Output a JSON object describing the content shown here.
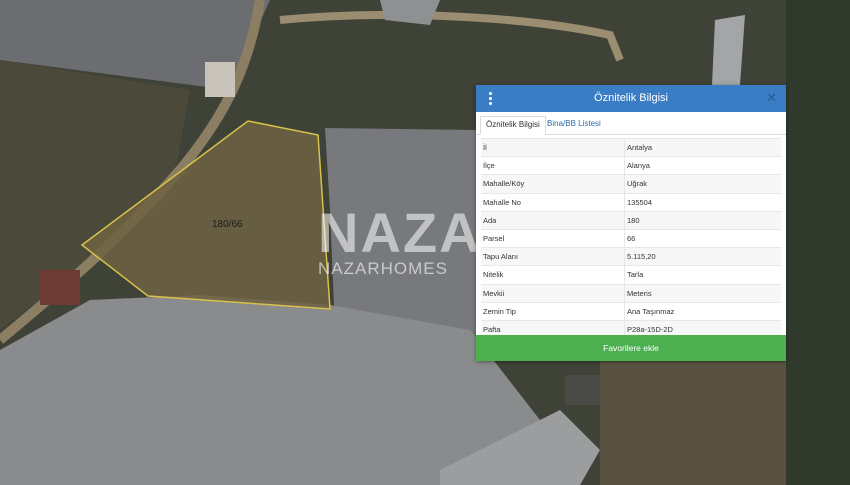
{
  "map": {
    "parcel_label": "180/66",
    "watermark": {
      "big": "NAZA",
      "small": "NAZARHOMES"
    }
  },
  "panel": {
    "title": "Öznitelik Bilgisi",
    "tabs": [
      {
        "label": "Öznitelik Bilgisi",
        "active": true
      },
      {
        "label": "Bina/BB Listesi",
        "active": false
      }
    ],
    "rows": [
      {
        "key": "İl",
        "value": "Antalya"
      },
      {
        "key": "İlçe",
        "value": "Alanya"
      },
      {
        "key": "Mahalle/Köy",
        "value": "Uğrak"
      },
      {
        "key": "Mahalle No",
        "value": "135504"
      },
      {
        "key": "Ada",
        "value": "180"
      },
      {
        "key": "Parsel",
        "value": "66"
      },
      {
        "key": "Tapu Alanı",
        "value": "5.115,20"
      },
      {
        "key": "Nitelik",
        "value": "Tarla"
      },
      {
        "key": "Mevkii",
        "value": "Meteris"
      },
      {
        "key": "Zemin Tip",
        "value": "Ana Taşınmaz"
      },
      {
        "key": "Pafta",
        "value": "P28a-15D-2D"
      }
    ],
    "favorite_button": "Favorilere ekle"
  },
  "colors": {
    "header": "#3b7dc4",
    "button": "#4caf50",
    "parcel_outline": "#d8c24a"
  },
  "icons": {
    "menu": "more-vertical-icon",
    "close": "close-icon"
  }
}
